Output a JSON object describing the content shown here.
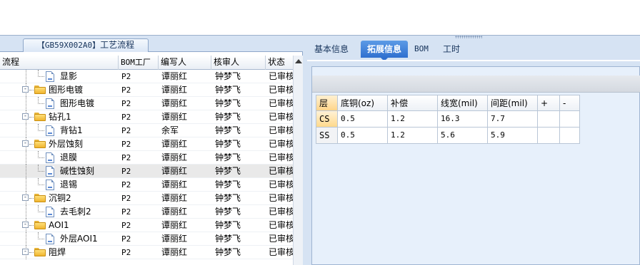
{
  "left": {
    "title_code": "【GB59X002A0】",
    "title_text": "工艺流程",
    "columns": [
      "流程",
      "BOM工厂",
      "编写人",
      "核审人",
      "状态"
    ],
    "rows": [
      {
        "depth": 2,
        "kind": "doc",
        "name": "显影",
        "bom": "P2",
        "writer": "谭丽红",
        "reviewer": "钟梦飞",
        "status": "已审核"
      },
      {
        "depth": 1,
        "kind": "folder",
        "name": "图形电镀",
        "bom": "P2",
        "writer": "谭丽红",
        "reviewer": "钟梦飞",
        "status": "已审核"
      },
      {
        "depth": 2,
        "kind": "doc",
        "name": "图形电镀",
        "bom": "P2",
        "writer": "谭丽红",
        "reviewer": "钟梦飞",
        "status": "已审核"
      },
      {
        "depth": 1,
        "kind": "folder",
        "name": "钻孔1",
        "bom": "P2",
        "writer": "谭丽红",
        "reviewer": "钟梦飞",
        "status": "已审核"
      },
      {
        "depth": 2,
        "kind": "doc",
        "name": "背钻1",
        "bom": "P2",
        "writer": "余军",
        "reviewer": "钟梦飞",
        "status": "已审核"
      },
      {
        "depth": 1,
        "kind": "folder",
        "name": "外层蚀刻",
        "bom": "P2",
        "writer": "谭丽红",
        "reviewer": "钟梦飞",
        "status": "已审核"
      },
      {
        "depth": 2,
        "kind": "doc",
        "name": "退膜",
        "bom": "P2",
        "writer": "谭丽红",
        "reviewer": "钟梦飞",
        "status": "已审核"
      },
      {
        "depth": 2,
        "kind": "doc",
        "name": "碱性蚀刻",
        "bom": "P2",
        "writer": "谭丽红",
        "reviewer": "钟梦飞",
        "status": "已审核",
        "selected": true
      },
      {
        "depth": 2,
        "kind": "doc",
        "name": "退锡",
        "bom": "P2",
        "writer": "谭丽红",
        "reviewer": "钟梦飞",
        "status": "已审核"
      },
      {
        "depth": 1,
        "kind": "folder",
        "name": "沉铜2",
        "bom": "P2",
        "writer": "谭丽红",
        "reviewer": "钟梦飞",
        "status": "已审核"
      },
      {
        "depth": 2,
        "kind": "doc",
        "name": "去毛刺2",
        "bom": "P2",
        "writer": "谭丽红",
        "reviewer": "钟梦飞",
        "status": "已审核"
      },
      {
        "depth": 1,
        "kind": "folder",
        "name": "AOI1",
        "bom": "P2",
        "writer": "谭丽红",
        "reviewer": "钟梦飞",
        "status": "已审核"
      },
      {
        "depth": 2,
        "kind": "doc",
        "name": "外层AOI1",
        "bom": "P2",
        "writer": "谭丽红",
        "reviewer": "钟梦飞",
        "status": "已审核"
      },
      {
        "depth": 1,
        "kind": "folder",
        "name": "阻焊",
        "bom": "P2",
        "writer": "谭丽红",
        "reviewer": "钟梦飞",
        "status": "已审核"
      }
    ]
  },
  "right": {
    "tabs": [
      {
        "label": "基本信息",
        "active": false
      },
      {
        "label": "拓展信息",
        "active": true
      },
      {
        "label": "BOM",
        "active": false
      },
      {
        "label": "工时",
        "active": false
      }
    ],
    "table": {
      "columns": [
        "层",
        "底铜(oz)",
        "补偿",
        "线宽(mil)",
        "间距(mil)",
        "+",
        "-"
      ],
      "rows": [
        [
          "CS",
          "0.5",
          "1.2",
          "16.3",
          "7.7",
          "",
          ""
        ],
        [
          "SS",
          "0.5",
          "1.2",
          "5.6",
          "5.9",
          "",
          ""
        ]
      ]
    }
  },
  "colors": {
    "panel_bg": "#d6e3f3",
    "active_tab": "#2f6fcf",
    "folder": "#f0b52f",
    "selected_row": "#e9e9e9"
  }
}
